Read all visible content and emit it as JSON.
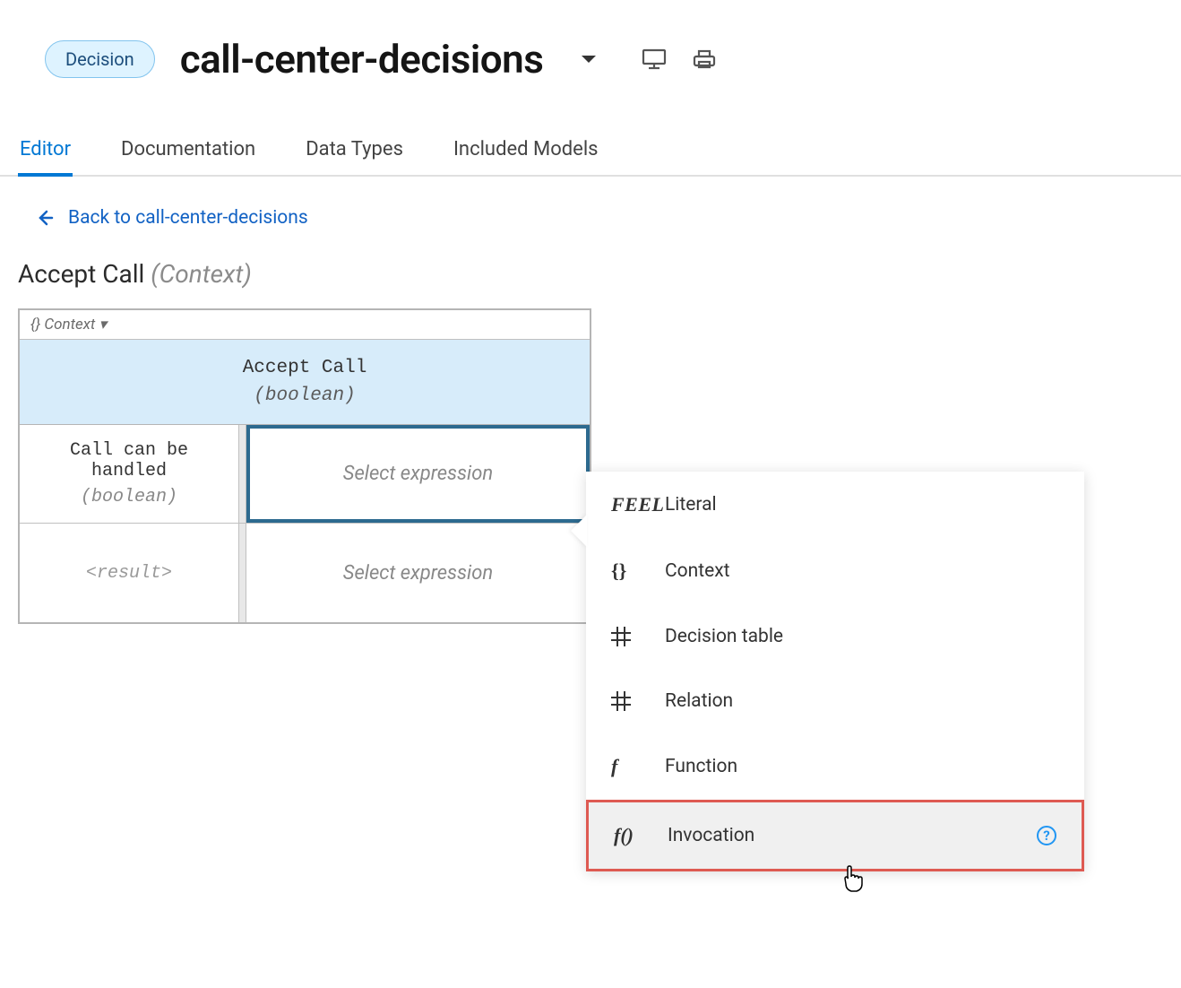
{
  "header": {
    "badge": "Decision",
    "title": "call-center-decisions"
  },
  "tabs": [
    {
      "label": "Editor",
      "active": true
    },
    {
      "label": "Documentation",
      "active": false
    },
    {
      "label": "Data Types",
      "active": false
    },
    {
      "label": "Included Models",
      "active": false
    }
  ],
  "back_link": "Back to call-center-decisions",
  "node": {
    "name": "Accept Call",
    "subtype": "(Context)",
    "context_label": "{}  Context ▾",
    "header_name": "Accept Call",
    "header_type": "(boolean)",
    "rows": [
      {
        "key": "Call can be handled",
        "ktype": "(boolean)",
        "value": "Select expression",
        "selected": true
      },
      {
        "key": "<result>",
        "ktype": "",
        "value": "Select expression",
        "selected": false
      }
    ]
  },
  "expression_menu": [
    {
      "icon": "feel",
      "icon_text": "FEEL",
      "label": "Literal"
    },
    {
      "icon": "braces",
      "icon_text": "{}",
      "label": "Context"
    },
    {
      "icon": "grid",
      "icon_text": "",
      "label": "Decision table"
    },
    {
      "icon": "grid",
      "icon_text": "",
      "label": "Relation"
    },
    {
      "icon": "f",
      "icon_text": "f",
      "label": "Function"
    },
    {
      "icon": "fparen",
      "icon_text": "f()",
      "label": "Invocation",
      "hovered": true,
      "help": true
    }
  ]
}
